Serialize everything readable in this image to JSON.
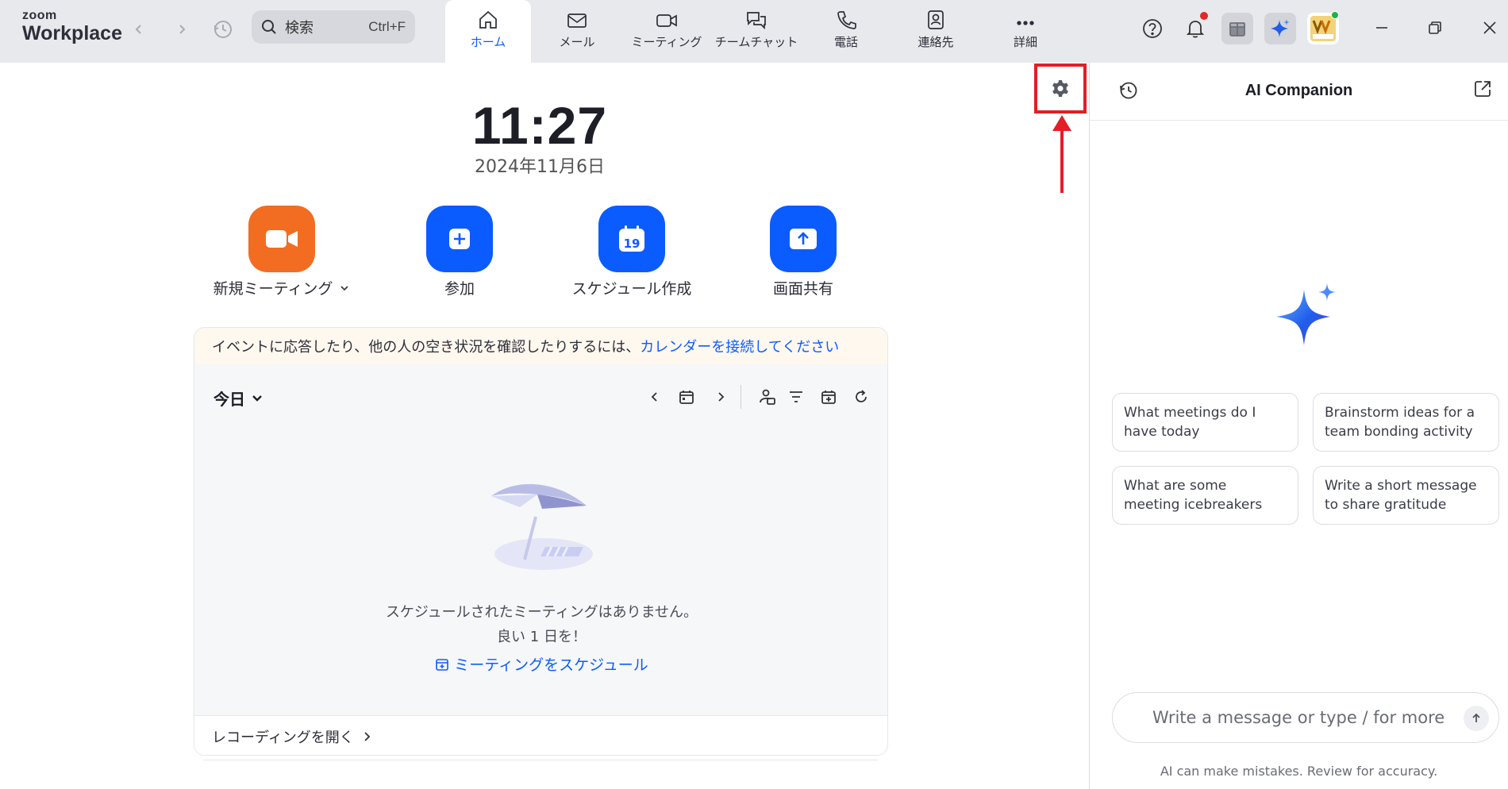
{
  "app": {
    "logo_line1": "zoom",
    "logo_line2": "Workplace"
  },
  "search": {
    "placeholder": "検索",
    "shortcut": "Ctrl+F"
  },
  "tabs": [
    {
      "label": "ホーム",
      "icon": "home-icon",
      "active": true
    },
    {
      "label": "メール",
      "icon": "mail-icon"
    },
    {
      "label": "ミーティング",
      "icon": "video-icon"
    },
    {
      "label": "チームチャット",
      "icon": "chat-icon"
    },
    {
      "label": "電話",
      "icon": "phone-icon"
    },
    {
      "label": "連絡先",
      "icon": "contacts-icon"
    },
    {
      "label": "詳細",
      "icon": "more-icon"
    }
  ],
  "colors": {
    "accent": "#0b5cff",
    "orange": "#f26d21",
    "highlight_red": "#e21e26"
  },
  "home": {
    "time": "11:27",
    "date": "2024年11月6日",
    "actions": [
      {
        "label": "新規ミーティング",
        "icon": "video-camera-icon"
      },
      {
        "label": "参加",
        "icon": "plus-icon"
      },
      {
        "label": "スケジュール作成",
        "icon": "calendar-icon",
        "badge": "19"
      },
      {
        "label": "画面共有",
        "icon": "share-screen-icon"
      }
    ],
    "banner_text": "イベントに応答したり、他の人の空き状況を確認したりするには、",
    "banner_link": "カレンダーを接続してください",
    "today_label": "今日",
    "empty_line1": "スケジュールされたミーティングはありません。",
    "empty_line2": "良い 1 日を！",
    "schedule_link": "ミーティングをスケジュール",
    "recordings": "レコーディングを開く"
  },
  "ai": {
    "title": "AI Companion",
    "prompts": [
      "What meetings do I have today",
      "Brainstorm ideas for a team bonding activity",
      "What are some meeting icebreakers",
      "Write a short message to share gratitude"
    ],
    "input_placeholder": "Write a message or type / for more",
    "disclaimer": "AI can make mistakes. Review for accuracy."
  }
}
